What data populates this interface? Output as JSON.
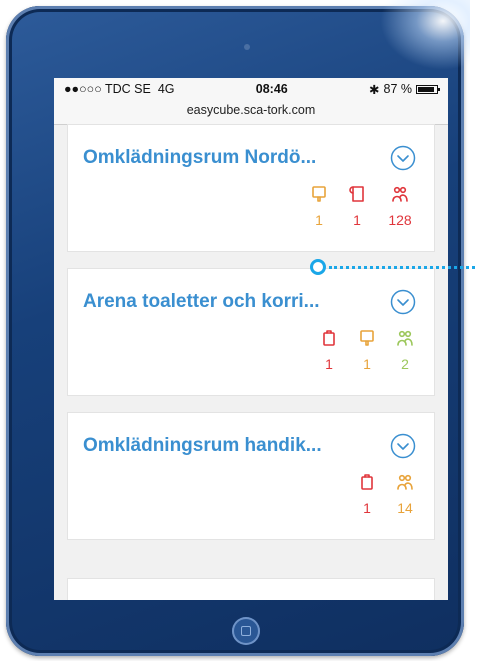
{
  "status_bar": {
    "signal": "●●○○○",
    "carrier": "TDC SE",
    "network": "4G",
    "time": "08:46",
    "bluetooth": "✱",
    "battery": "87 %",
    "battery_level": 0.87
  },
  "url": "easycube.sca-tork.com",
  "colors": {
    "title": "#3a8fd0",
    "orange": "#e8a33a",
    "red": "#e0353b",
    "green": "#9cc75b",
    "callout": "#1aa7e8"
  },
  "cards": [
    {
      "title": "Omklädningsrum Nordö...",
      "metrics": [
        {
          "icon": "soap-dispenser-icon",
          "value": "1",
          "color": "orange"
        },
        {
          "icon": "paper-towel-icon",
          "value": "1",
          "color": "red"
        },
        {
          "icon": "people-icon",
          "value": "128",
          "color": "red"
        }
      ]
    },
    {
      "title": "Arena toaletter och korri...",
      "metrics": [
        {
          "icon": "toilet-paper-icon",
          "value": "1",
          "color": "red"
        },
        {
          "icon": "soap-dispenser-icon",
          "value": "1",
          "color": "orange"
        },
        {
          "icon": "people-icon",
          "value": "2",
          "color": "green"
        }
      ]
    },
    {
      "title": "Omklädningsrum handik...",
      "metrics": [
        {
          "icon": "toilet-paper-icon",
          "value": "1",
          "color": "red"
        },
        {
          "icon": "people-icon",
          "value": "14",
          "color": "orange"
        }
      ]
    }
  ]
}
